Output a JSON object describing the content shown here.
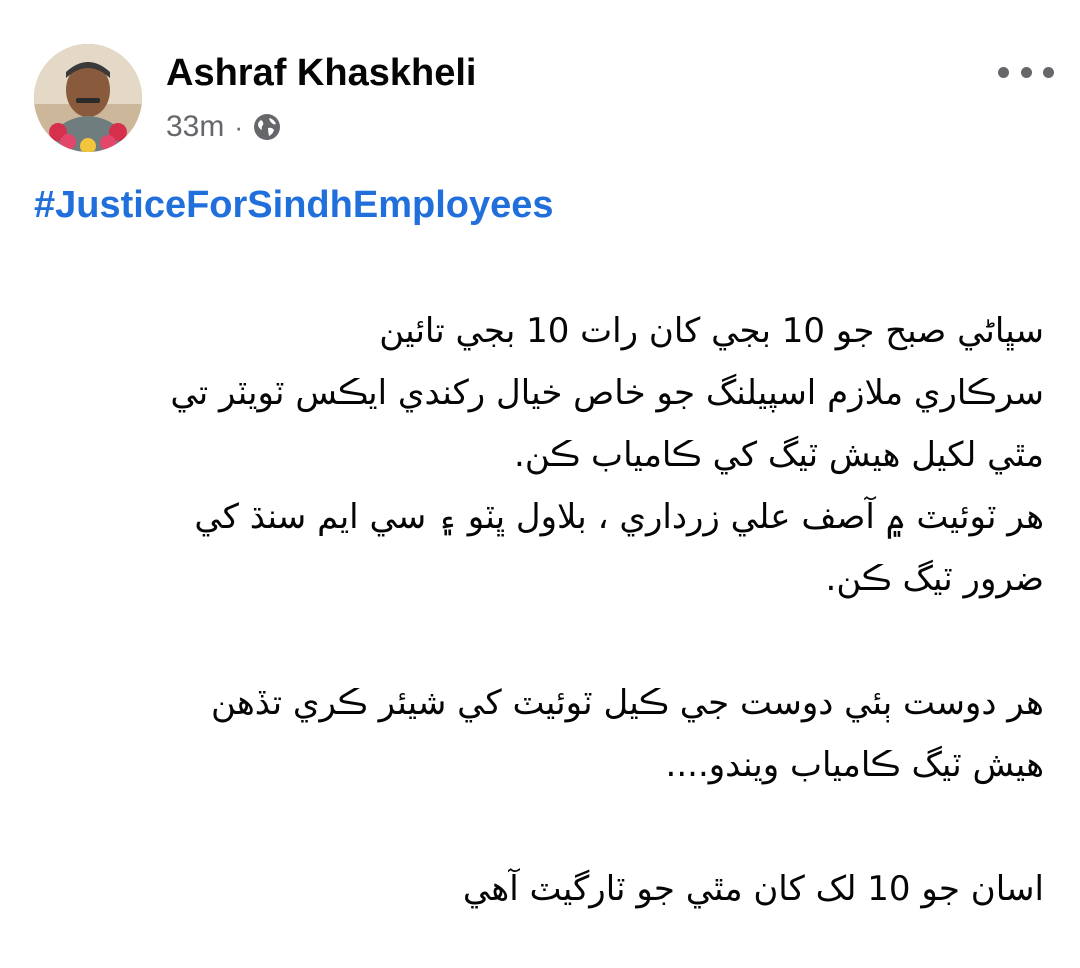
{
  "post": {
    "author": "Ashraf Khaskheli",
    "time": "33m",
    "meta_separator": "·",
    "audience_icon": "globe-icon",
    "more_icon": "more-options-icon",
    "hashtag": "#JusticeForSindhEmployees",
    "hashtag_color": "#216fdb",
    "body": {
      "p1_line1": "سڀاڻي صبح جو 10 بجي کان رات 10 بجي تائين",
      "p1_line2": "سرڪاري ملازم اسپيلنگ جو خاص خيال رکندي ايڪس ٽويٽر تي",
      "p1_line3": "مٿي لکيل هيش ٽيگ کي ڪامياب ڪن.",
      "p1_line4": "هر ٽوئيٽ ۾ آصف علي زرداري ، بلاول ڀٽو ۽ سي ايم سنڌ کي",
      "p1_line5": "ضرور ٽيگ ڪن.",
      "p2_line1": "هر دوست ٻئي دوست جي ڪيل ٽوئيٽ کي شيئر ڪري تڏهن",
      "p2_line2": "هيش ٽيگ ڪامياب ويندو....",
      "p3_line1": "اسان جو 10 لک کان مٿي جو ٽارگيٽ آهي"
    }
  }
}
